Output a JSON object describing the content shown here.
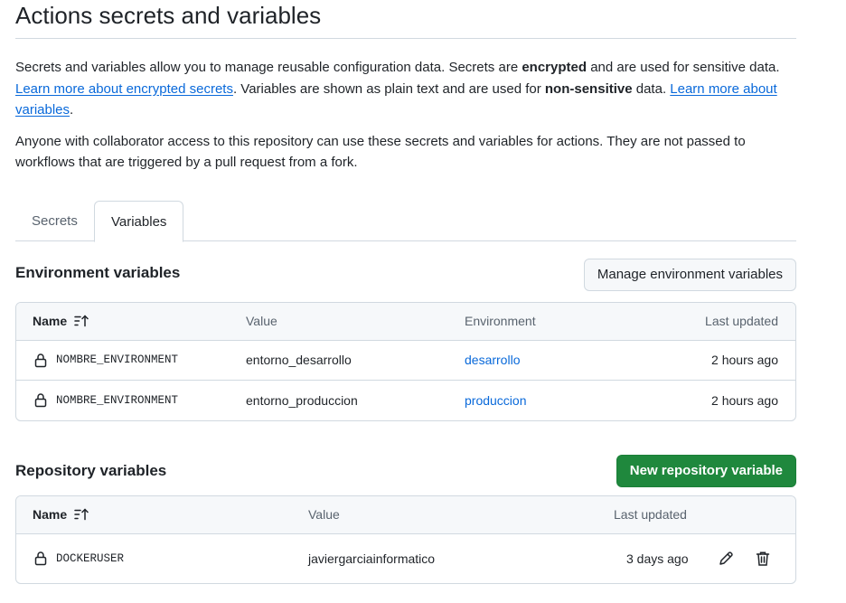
{
  "page": {
    "title": "Actions secrets and variables"
  },
  "intro": {
    "p1_a": "Secrets and variables allow you to manage reusable configuration data. Secrets are ",
    "p1_b": "encrypted",
    "p1_c": " and are used for sensitive data. ",
    "p1_link1": "Learn more about encrypted secrets",
    "p1_d": ". Variables are shown as plain text and are used for ",
    "p1_e": "non-sensitive",
    "p1_f": " data. ",
    "p1_link2": "Learn more about variables",
    "p1_g": ".",
    "p2": "Anyone with collaborator access to this repository can use these secrets and variables for actions. They are not passed to workflows that are triggered by a pull request from a fork."
  },
  "tabs": [
    {
      "label": "Secrets",
      "active": false
    },
    {
      "label": "Variables",
      "active": true
    }
  ],
  "environment": {
    "title": "Environment variables",
    "button": "Manage environment variables",
    "headers": {
      "name": "Name",
      "value": "Value",
      "environment": "Environment",
      "updated": "Last updated"
    },
    "rows": [
      {
        "name": "NOMBRE_ENVIRONMENT",
        "value": "entorno_desarrollo",
        "environment": "desarrollo",
        "updated": "2 hours ago"
      },
      {
        "name": "NOMBRE_ENVIRONMENT",
        "value": "entorno_produccion",
        "environment": "produccion",
        "updated": "2 hours ago"
      }
    ]
  },
  "repository": {
    "title": "Repository variables",
    "button": "New repository variable",
    "headers": {
      "name": "Name",
      "value": "Value",
      "updated": "Last updated"
    },
    "rows": [
      {
        "name": "DOCKERUSER",
        "value": "javiergarciainformatico",
        "updated": "3 days ago"
      }
    ]
  },
  "icons": {
    "sort": "sort-ascending-icon",
    "lock": "lock-icon",
    "edit": "pencil-icon",
    "delete": "trash-icon"
  },
  "colors": {
    "link": "#0969da",
    "primary_button": "#1f883d",
    "border": "#d1d9e0",
    "header_bg": "#f6f8fa"
  }
}
